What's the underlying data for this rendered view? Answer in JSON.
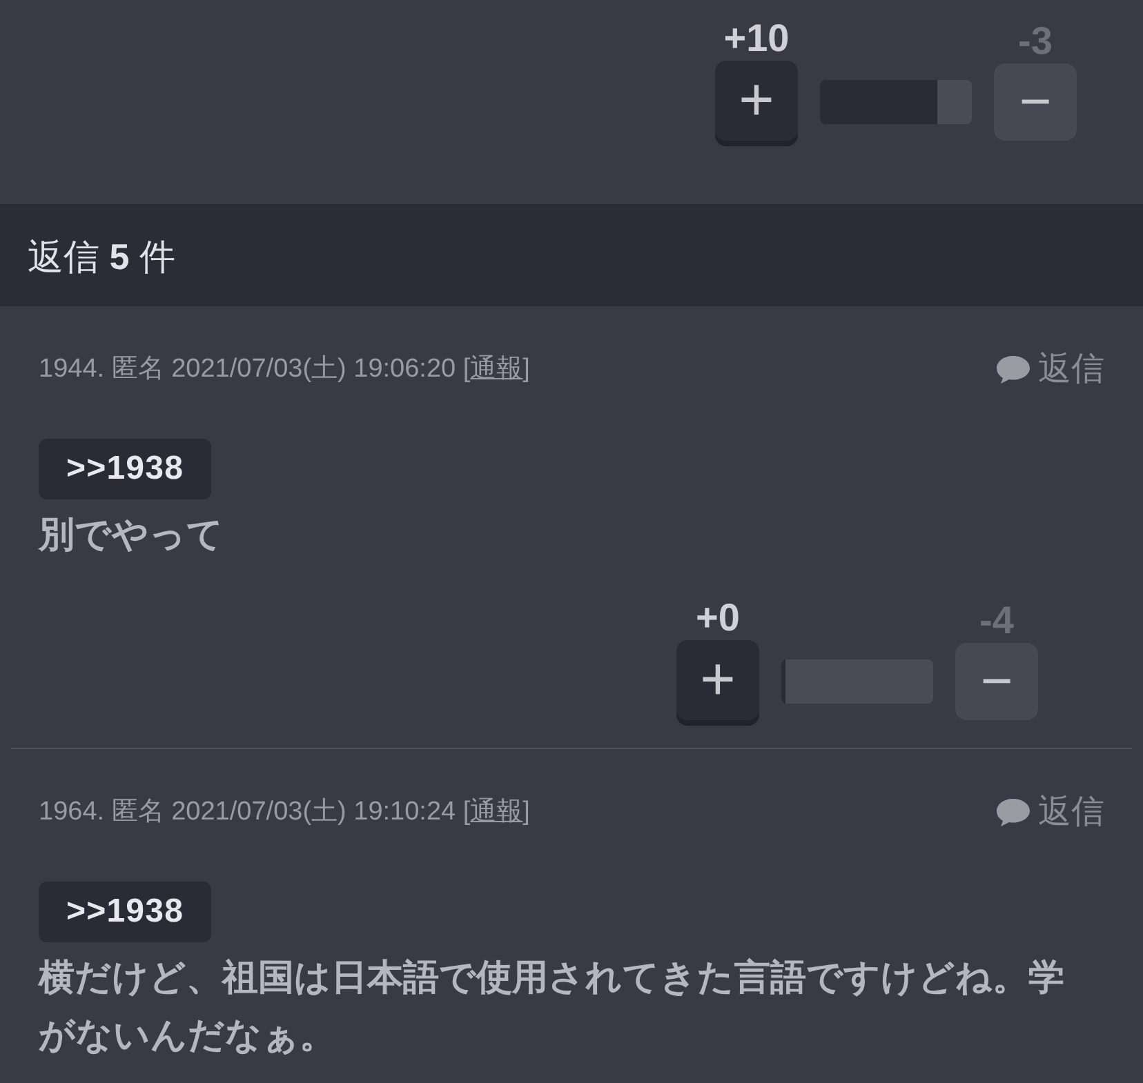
{
  "top_vote": {
    "plus_count": "+10",
    "minus_count": "-3",
    "level": 0.77,
    "plus_symbol": "+",
    "minus_symbol": "−"
  },
  "replies_header": "返信 **5** 件",
  "comments": [
    {
      "number": "1944.",
      "author": "匿名",
      "datetime": "2021/07/03(土) 19:06:20",
      "bracket_open": "[",
      "report_link": "通報",
      "bracket_close": "]",
      "reply_label": "返信",
      "quote": ">>1938",
      "body": "別でやって",
      "vote": {
        "plus_count": "+0",
        "minus_count": "-4",
        "level": 0.03,
        "plus_symbol": "+",
        "minus_symbol": "−"
      }
    },
    {
      "number": "1964.",
      "author": "匿名",
      "datetime": "2021/07/03(土) 19:10:24",
      "bracket_open": "[",
      "report_link": "通報",
      "bracket_close": "]",
      "reply_label": "返信",
      "quote": ">>1938",
      "body": "横だけど、祖国は日本語で使用されてきた言語ですけどね。学がないんだなぁ。"
    }
  ]
}
